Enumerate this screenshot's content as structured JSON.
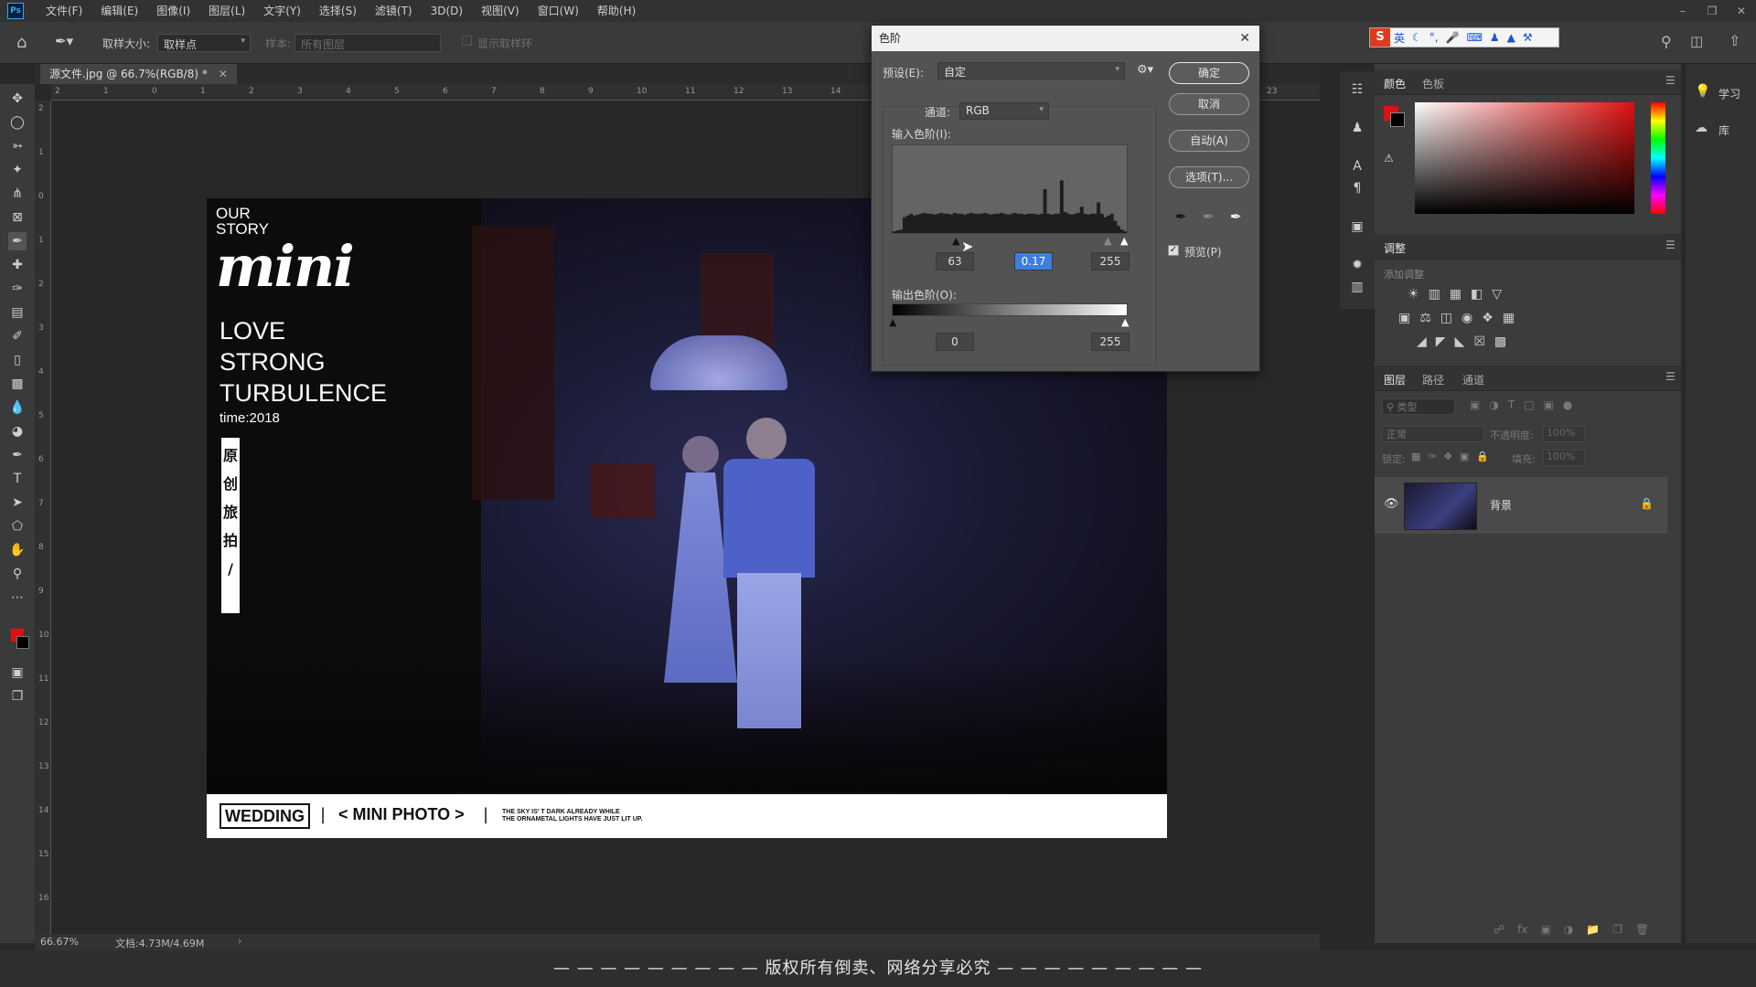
{
  "app": {
    "logo": "Ps",
    "menus": [
      "文件(F)",
      "编辑(E)",
      "图像(I)",
      "图层(L)",
      "文字(Y)",
      "选择(S)",
      "滤镜(T)",
      "3D(D)",
      "视图(V)",
      "窗口(W)",
      "帮助(H)"
    ]
  },
  "options_bar": {
    "sample_size_label": "取样大小:",
    "sample_size_value": "取样点",
    "sample_label": "样本:",
    "sample_value": "所有图层",
    "show_ring": "显示取样环"
  },
  "document": {
    "tab_title": "源文件.jpg @ 66.7%(RGB/8) *",
    "zoom": "66.67%",
    "doc_size": "文档:4.73M/4.69M",
    "ruler_top": [
      "2",
      "1",
      "0",
      "1",
      "2",
      "3",
      "4",
      "5",
      "6",
      "7",
      "8",
      "9",
      "10",
      "11",
      "12",
      "13",
      "14",
      "15",
      "16",
      "17",
      "18",
      "19",
      "20",
      "21",
      "22",
      "23"
    ],
    "ruler_left": [
      "2",
      "1",
      "0",
      "1",
      "2",
      "3",
      "4",
      "5",
      "6",
      "7",
      "8",
      "9",
      "10",
      "11",
      "12",
      "13",
      "14",
      "15",
      "16"
    ]
  },
  "poster": {
    "our_story": "OUR STORY",
    "brand": "mini",
    "line1": "LOVE",
    "line2": "STRONG",
    "line3": "TURBULENCE",
    "time": "time:2018",
    "vertical": [
      "原",
      "创",
      "旅",
      "拍",
      "/"
    ],
    "footer_logo": "WEDDING",
    "footer_sep": "|",
    "footer_title": "< MINI PHOTO >",
    "footer_tag1": "THE SKY IS'  T DARK ALREADY WHILE",
    "footer_tag2": "THE ORNAMETAL LIGHTS HAVE JUST LIT UP."
  },
  "dialog": {
    "title": "色阶",
    "preset_label": "预设(E):",
    "preset_value": "自定",
    "channel_label": "通道:",
    "channel_value": "RGB",
    "input_label": "输入色阶(I):",
    "input_black": "63",
    "input_gamma": "0.17",
    "input_white": "255",
    "output_label": "输出色阶(O):",
    "output_black": "0",
    "output_white": "255",
    "ok": "确定",
    "cancel": "取消",
    "auto": "自动(A)",
    "options": "选项(T)...",
    "preview": "预览(P)",
    "preview_checked": true
  },
  "panels": {
    "color_tabs": [
      "颜色",
      "色板"
    ],
    "learn": "学习",
    "library": "库",
    "adjust_tab": "调整",
    "adjust_hint": "添加调整",
    "layers_tabs": [
      "图层",
      "路径",
      "通道"
    ],
    "search_placeholder": "类型",
    "blend_mode": "正常",
    "opacity_label": "不透明度:",
    "opacity_value": "100%",
    "lock_label": "锁定:",
    "fill_label": "填充:",
    "fill_value": "100%",
    "layer_name": "背景",
    "fg_color": "#e01010",
    "bg_color": "#000000"
  },
  "ime": {
    "lang": "英"
  },
  "banner": "— — — — — — — — — 版权所有倒卖、网络分享必究 — — — — — — — — —",
  "histogram": [
    2,
    3,
    4,
    18,
    20,
    22,
    20,
    21,
    22,
    23,
    22,
    22,
    21,
    22,
    23,
    22,
    22,
    21,
    23,
    22,
    22,
    21,
    22,
    23,
    22,
    22,
    22,
    23,
    22,
    21,
    22,
    22,
    23,
    22,
    21,
    22,
    23,
    22,
    22,
    21,
    22,
    22,
    22,
    21,
    22,
    50,
    22,
    21,
    22,
    22,
    60,
    24,
    22,
    21,
    22,
    23,
    30,
    22,
    21,
    22,
    22,
    35,
    22,
    18,
    20,
    22,
    14,
    8,
    4,
    2
  ]
}
